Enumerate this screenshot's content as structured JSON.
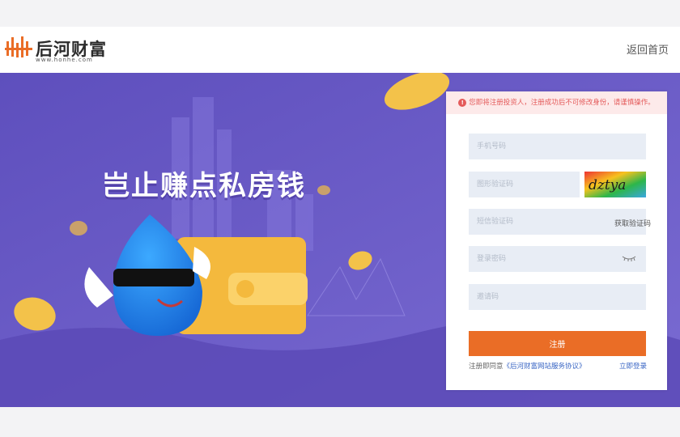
{
  "header": {
    "logo_text": "后河财富",
    "logo_url": "www.honhe.com",
    "home_link": "返回首页"
  },
  "banner": {
    "slogan": "岂止赚点私房钱"
  },
  "form": {
    "notice": "您即将注册投资人，注册成功后不可修改身份，请谨慎操作。",
    "phone_placeholder": "手机号码",
    "captcha_placeholder": "图形验证码",
    "captcha_text": "dztya",
    "sms_placeholder": "短信验证码",
    "sms_button": "获取验证码",
    "password_placeholder": "登录密码",
    "invite_placeholder": "邀请码",
    "submit_label": "注册",
    "agree_prefix": "注册即同意",
    "agree_link": "《后河财富网站服务协议》",
    "login_link": "立即登录"
  },
  "colors": {
    "accent": "#ea6d26",
    "banner": "#6b5cc4",
    "notice": "#e45a5a",
    "link": "#3a66c4"
  }
}
